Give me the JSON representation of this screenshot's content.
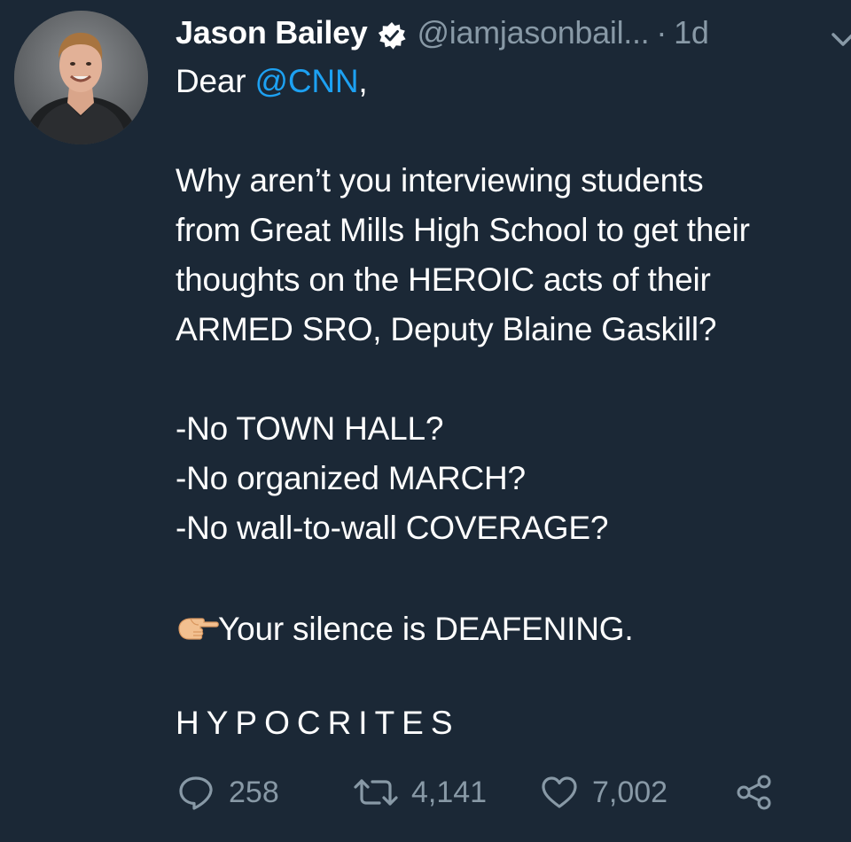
{
  "author": {
    "name": "Jason Bailey",
    "handle": "@iamjasonbail...",
    "separator": "·",
    "time": "1d"
  },
  "icons": {
    "verified": "verified-badge-icon",
    "menu": "chevron-down-icon",
    "pointer": "backhand-index-pointing-right-emoji",
    "reply": "reply-icon",
    "retweet": "retweet-icon",
    "like": "heart-icon",
    "share": "share-icon"
  },
  "tweet": {
    "greeting_prefix": "Dear ",
    "mention": "@CNN",
    "greeting_suffix": ",",
    "paragraph_lines": [
      "Why aren’t you interviewing students",
      "from Great Mills High School to get their",
      "thoughts on the HEROIC acts of their",
      "ARMED SRO, Deputy Blaine Gaskill?"
    ],
    "list_lines": [
      "-No TOWN HALL?",
      "-No organized MARCH?",
      "-No wall-to-wall COVERAGE?"
    ],
    "silence_line": "Your silence is DEAFENING.",
    "closing": "HYPOCRITES"
  },
  "stats": {
    "replies": "258",
    "retweets": "4,141",
    "likes": "7,002"
  },
  "colors": {
    "background": "#1b2836",
    "text": "#ffffff",
    "muted": "#8899a6",
    "link": "#1da1f2"
  }
}
